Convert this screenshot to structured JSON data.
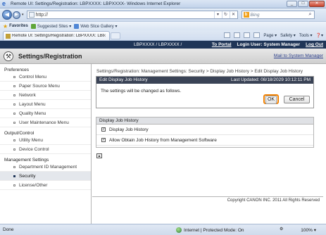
{
  "window": {
    "title": "Remote UI: Settings/Registration: LBPXXXX: LBPXXXX- Windows Internet Explorer",
    "minimize": "_",
    "maximize": "□",
    "close": "✕"
  },
  "address_bar": {
    "back": "◀",
    "forward": "▶",
    "url": "http://",
    "search_placeholder": "Bing"
  },
  "favorites_bar": {
    "favorites_label": "Favorites",
    "items": [
      "Suggested Sites ▾",
      "Web Slice Gallery ▾"
    ]
  },
  "tab": {
    "label": "Remote UI: Settings/Registration: LBPXXXX: LBPX...",
    "close": "x"
  },
  "command_bar": {
    "page": "Page ▾",
    "safety": "Safety ▾",
    "tools": "Tools ▾",
    "help": "❓▾"
  },
  "topbar": {
    "device": "LBPXXXX / LBPXXXX /",
    "to_portal": "To Portal",
    "login_user": "Login User: System Manager",
    "log_out": "Log Out"
  },
  "header": {
    "title": "Settings/Registration",
    "mail_link": "Mail to System Manager"
  },
  "sidebar": {
    "groups": [
      {
        "label": "Preferences",
        "items": [
          "Control Menu",
          "Paper Source Menu",
          "Network",
          "Layout Menu",
          "Quality Menu",
          "User Maintenance Menu"
        ]
      },
      {
        "label": "Output/Control",
        "items": [
          "Utility Menu",
          "Device Control"
        ]
      },
      {
        "label": "Management Settings",
        "items": [
          "Department ID Management",
          "Security",
          "License/Other"
        ]
      }
    ]
  },
  "main": {
    "breadcrumb": "Settings/Registration: Management Settings: Security > Display Job History > Edit Display Job History",
    "edit_panel": {
      "title": "Edit Display Job History",
      "last_updated": "Last Updated: 08/18/2029 10:12:11 PM",
      "message": "The settings will be changed as follows.",
      "ok_label": "OK",
      "cancel_label": "Cancel"
    },
    "display_panel": {
      "title": "Display Job History",
      "options": [
        {
          "label": "Display Job History",
          "checked": true
        },
        {
          "label": "Allow Obtain Job History from Management Software",
          "checked": true
        }
      ]
    },
    "top_arrow": "▲",
    "footer": "Copyright CANON INC. 2011 All Rights Reserved"
  },
  "statusbar": {
    "status": "Done",
    "zone": "Internet | Protected Mode: On",
    "zoom": "100% ▾"
  }
}
